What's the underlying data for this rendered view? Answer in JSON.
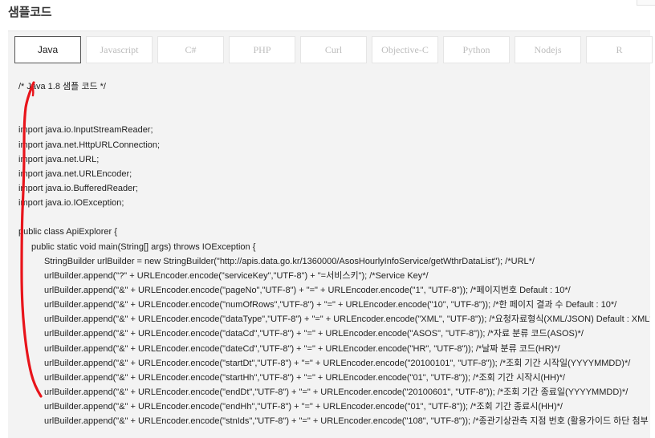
{
  "page": {
    "title": "샘플코드"
  },
  "tabs": [
    {
      "label": "Java",
      "active": true
    },
    {
      "label": "Javascript",
      "active": false
    },
    {
      "label": "C#",
      "active": false
    },
    {
      "label": "PHP",
      "active": false
    },
    {
      "label": "Curl",
      "active": false
    },
    {
      "label": "Objective-C",
      "active": false
    },
    {
      "label": "Python",
      "active": false
    },
    {
      "label": "Nodejs",
      "active": false
    },
    {
      "label": "R",
      "active": false
    }
  ],
  "code": {
    "lines": [
      {
        "text": "/* Java 1.8 샘플 코드 */",
        "indent": 0
      },
      {
        "text": "",
        "indent": 0
      },
      {
        "text": "",
        "indent": 0
      },
      {
        "text": "import java.io.InputStreamReader;",
        "indent": 0
      },
      {
        "text": "import java.net.HttpURLConnection;",
        "indent": 0
      },
      {
        "text": "import java.net.URL;",
        "indent": 0
      },
      {
        "text": "import java.net.URLEncoder;",
        "indent": 0
      },
      {
        "text": "import java.io.BufferedReader;",
        "indent": 0
      },
      {
        "text": "import java.io.IOException;",
        "indent": 0
      },
      {
        "text": "",
        "indent": 0
      },
      {
        "text": "public class ApiExplorer {",
        "indent": 0
      },
      {
        "text": "public static void main(String[] args) throws IOException {",
        "indent": 1
      },
      {
        "text": "StringBuilder urlBuilder = new StringBuilder(\"http://apis.data.go.kr/1360000/AsosHourlyInfoService/getWthrDataList\"); /*URL*/",
        "indent": 2
      },
      {
        "text": "urlBuilder.append(\"?\" + URLEncoder.encode(\"serviceKey\",\"UTF-8\") + \"=서비스키\"); /*Service Key*/",
        "indent": 2
      },
      {
        "text": "urlBuilder.append(\"&\" + URLEncoder.encode(\"pageNo\",\"UTF-8\") + \"=\" + URLEncoder.encode(\"1\", \"UTF-8\")); /*페이지번호 Default : 10*/",
        "indent": 2
      },
      {
        "text": "urlBuilder.append(\"&\" + URLEncoder.encode(\"numOfRows\",\"UTF-8\") + \"=\" + URLEncoder.encode(\"10\", \"UTF-8\")); /*한 페이지 결과 수 Default : 10*/",
        "indent": 2
      },
      {
        "text": "urlBuilder.append(\"&\" + URLEncoder.encode(\"dataType\",\"UTF-8\") + \"=\" + URLEncoder.encode(\"XML\", \"UTF-8\")); /*요청자료형식(XML/JSON) Default : XML*/",
        "indent": 2
      },
      {
        "text": "urlBuilder.append(\"&\" + URLEncoder.encode(\"dataCd\",\"UTF-8\") + \"=\" + URLEncoder.encode(\"ASOS\", \"UTF-8\")); /*자료 분류 코드(ASOS)*/",
        "indent": 2
      },
      {
        "text": "urlBuilder.append(\"&\" + URLEncoder.encode(\"dateCd\",\"UTF-8\") + \"=\" + URLEncoder.encode(\"HR\", \"UTF-8\")); /*날짜 분류 코드(HR)*/",
        "indent": 2
      },
      {
        "text": "urlBuilder.append(\"&\" + URLEncoder.encode(\"startDt\",\"UTF-8\") + \"=\" + URLEncoder.encode(\"20100101\", \"UTF-8\")); /*조회 기간 시작일(YYYYMMDD)*/",
        "indent": 2
      },
      {
        "text": "urlBuilder.append(\"&\" + URLEncoder.encode(\"startHh\",\"UTF-8\") + \"=\" + URLEncoder.encode(\"01\", \"UTF-8\")); /*조회 기간 시작시(HH)*/",
        "indent": 2
      },
      {
        "text": "urlBuilder.append(\"&\" + URLEncoder.encode(\"endDt\",\"UTF-8\") + \"=\" + URLEncoder.encode(\"20100601\", \"UTF-8\")); /*조회 기간 종료일(YYYYMMDD)*/",
        "indent": 2
      },
      {
        "text": "urlBuilder.append(\"&\" + URLEncoder.encode(\"endHh\",\"UTF-8\") + \"=\" + URLEncoder.encode(\"01\", \"UTF-8\")); /*조회 기간 종료시(HH)*/",
        "indent": 2
      },
      {
        "text": "urlBuilder.append(\"&\" + URLEncoder.encode(\"stnIds\",\"UTF-8\") + \"=\" + URLEncoder.encode(\"108\", \"UTF-8\")); /*종관기상관측 지점 번호 (활용가이드 하단 첨부 참조)*/",
        "indent": 2
      }
    ]
  },
  "colors": {
    "annotation_stroke": "#e8141b",
    "panel_background": "#f3f3f3",
    "active_tab_border": "#555555",
    "inactive_tab_text": "#bcbcbc"
  }
}
